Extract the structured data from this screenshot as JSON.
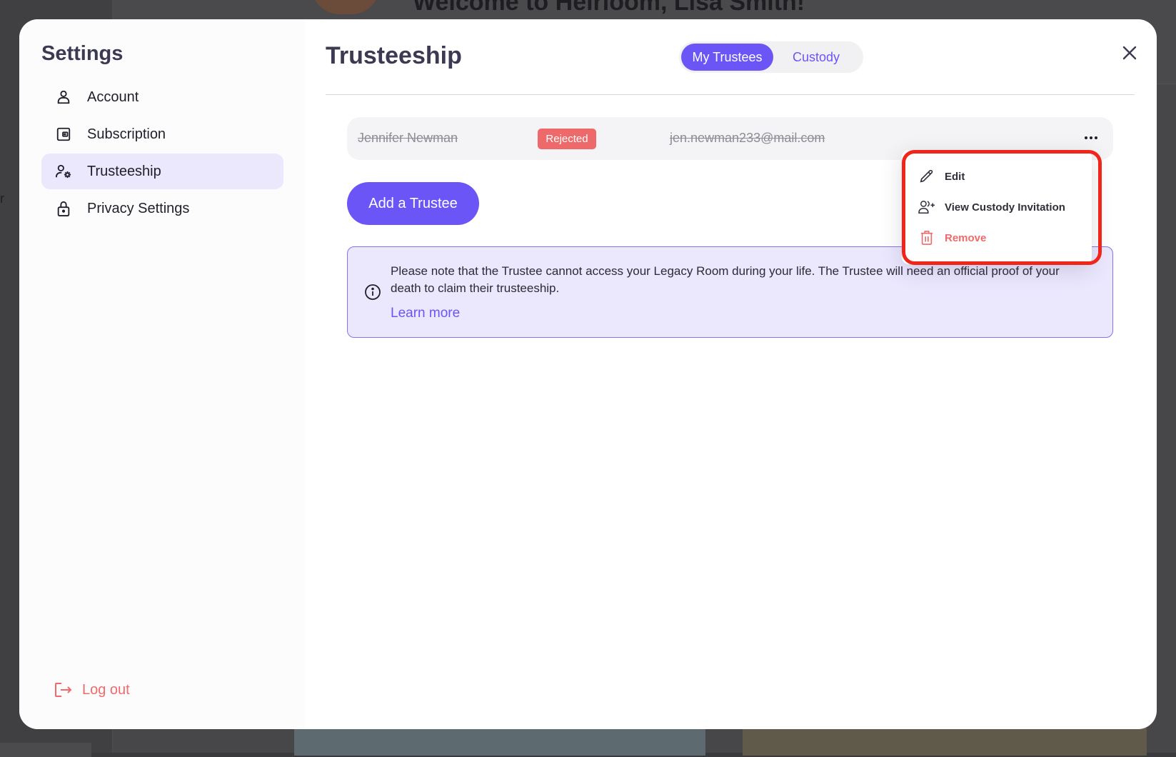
{
  "background": {
    "heading": "Welcome to Heirloom, Lisa Smith!",
    "side_letter": "r"
  },
  "sidebar": {
    "title": "Settings",
    "items": [
      {
        "label": "Account",
        "icon": "user-icon"
      },
      {
        "label": "Subscription",
        "icon": "wallet-icon"
      },
      {
        "label": "Trusteeship",
        "icon": "user-gear-icon",
        "active": true
      },
      {
        "label": "Privacy Settings",
        "icon": "lock-icon"
      }
    ],
    "logout_label": "Log out"
  },
  "main": {
    "title": "Trusteeship",
    "tabs": [
      {
        "label": "My Trustees",
        "selected": true
      },
      {
        "label": "Custody",
        "selected": false
      }
    ],
    "trustee": {
      "name": "Jennifer Newman",
      "status": "Rejected",
      "email": "jen.newman233@mail.com"
    },
    "add_button_label": "Add a Trustee",
    "info": {
      "text": "Please note that the Trustee cannot access your Legacy Room during your life. The Trustee will need an official proof of your death to claim their trusteeship.",
      "link": "Learn more"
    }
  },
  "context_menu": {
    "items": [
      {
        "label": "Edit",
        "icon": "pencil-icon"
      },
      {
        "label": "View Custody Invitation",
        "icon": "user-plus-icon"
      },
      {
        "label": "Remove",
        "icon": "trash-icon"
      }
    ]
  },
  "colors": {
    "accent": "#6b55f6",
    "accent_light": "#ebe7fd",
    "danger": "#ef6a6a",
    "highlight": "#f0261a"
  }
}
